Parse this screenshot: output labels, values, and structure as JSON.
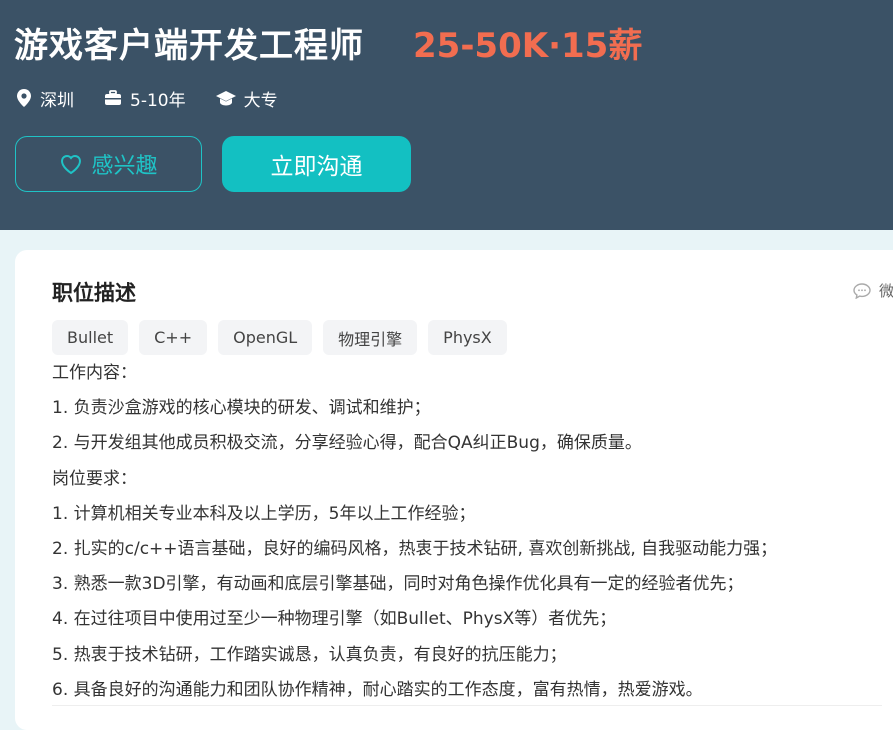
{
  "job": {
    "title": "游戏客户端开发工程师",
    "salary": "25-50K·15薪",
    "location": "深圳",
    "experience": "5-10年",
    "education": "大专"
  },
  "actions": {
    "interest_label": "感兴趣",
    "chat_label": "立即沟通"
  },
  "description": {
    "title": "职位描述",
    "wechat_label": "微",
    "tags": [
      "Bullet",
      "C++",
      "OpenGL",
      "物理引擎",
      "PhysX"
    ],
    "lines": [
      "工作内容：",
      "1. 负责沙盒游戏的核心模块的研发、调试和维护；",
      "2. 与开发组其他成员积极交流，分享经验心得，配合QA纠正Bug，确保质量。",
      "岗位要求：",
      "1. 计算机相关专业本科及以上学历，5年以上工作经验；",
      "2. 扎实的c/c++语言基础，良好的编码风格，热衷于技术钻研, 喜欢创新挑战, 自我驱动能力强；",
      "3. 熟悉一款3D引擎，有动画和底层引擎基础，同时对角色操作优化具有一定的经验者优先；",
      "4. 在过往项目中使用过至少一种物理引擎（如Bullet、PhysX等）者优先；",
      "5. 热衷于技术钻研，工作踏实诚恳，认真负责，有良好的抗压能力；",
      "6. 具备良好的沟通能力和团队协作精神，耐心踏实的工作态度，富有热情，热爱游戏。"
    ]
  },
  "icons": {
    "location": "location-pin-icon",
    "experience": "briefcase-icon",
    "education": "graduation-cap-icon",
    "interest": "heart-icon",
    "wechat": "chat-bubble-icon"
  },
  "colors": {
    "header_bg": "#3b5266",
    "salary": "#f26d50",
    "accent": "#13c0c2",
    "page_bg": "#e8f4f7"
  }
}
